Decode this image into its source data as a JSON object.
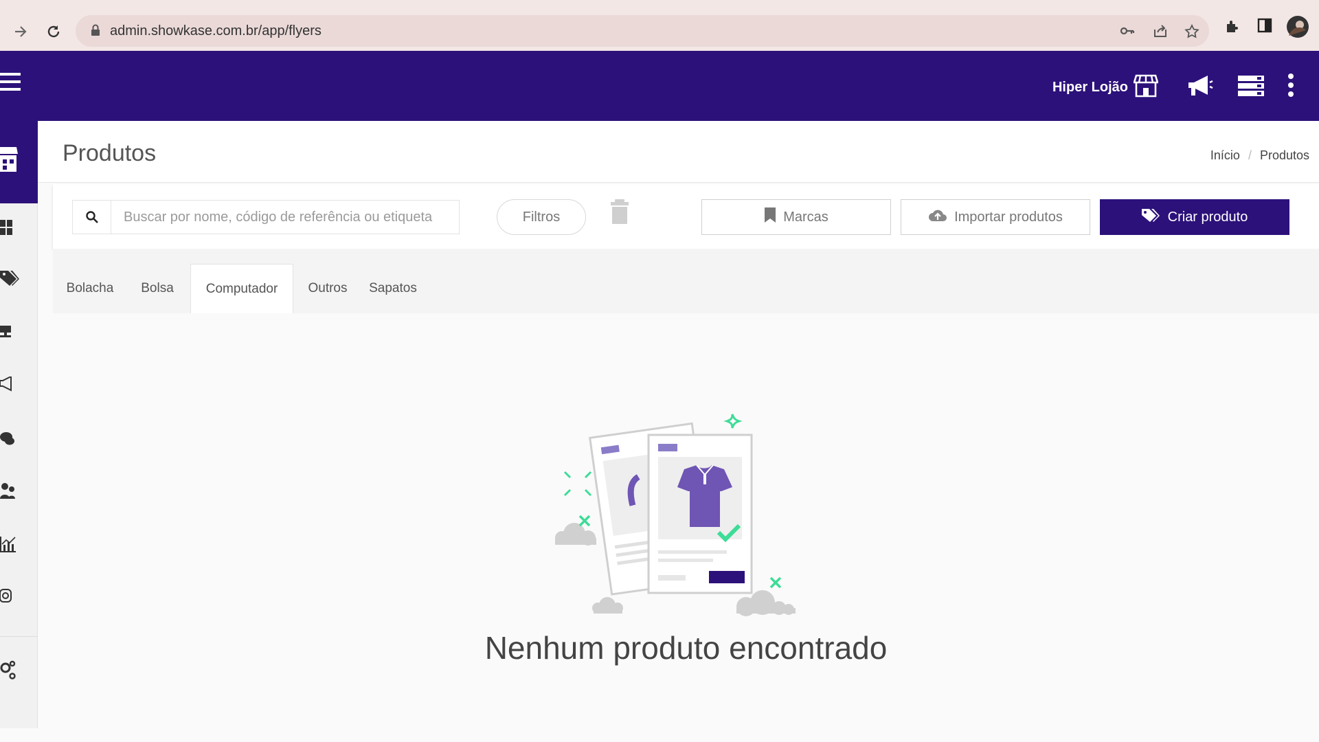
{
  "browser": {
    "url": "admin.showkase.com.br/app/flyers"
  },
  "header": {
    "store_name": "Hiper Lojão",
    "icons": [
      "menu-icon",
      "store-icon",
      "megaphone-icon",
      "list-icon",
      "more-vert-icon"
    ]
  },
  "sidebar": {
    "items": [
      "store-icon",
      "dashboard-icon",
      "tags-icon",
      "display-icon",
      "megaphone-icon",
      "chat-icon",
      "users-icon",
      "chart-icon",
      "instagram-icon",
      "settings-icon"
    ]
  },
  "page": {
    "title": "Produtos",
    "breadcrumb": [
      "Início",
      "Produtos"
    ]
  },
  "toolbar": {
    "search_placeholder": "Buscar por nome, código de referência ou etiqueta",
    "filters_label": "Filtros",
    "brands_label": "Marcas",
    "import_label": "Importar produtos",
    "create_label": "Criar produto"
  },
  "tabs": [
    {
      "label": "Bolacha",
      "active": false
    },
    {
      "label": "Bolsa",
      "active": false
    },
    {
      "label": "Computador",
      "active": true
    },
    {
      "label": "Outros",
      "active": false
    },
    {
      "label": "Sapatos",
      "active": false
    }
  ],
  "empty_state": {
    "message": "Nenhum produto encontrado"
  },
  "colors": {
    "primary": "#2c117a",
    "accent_green": "#3ddc97",
    "illustration_purple": "#6f55b4"
  }
}
